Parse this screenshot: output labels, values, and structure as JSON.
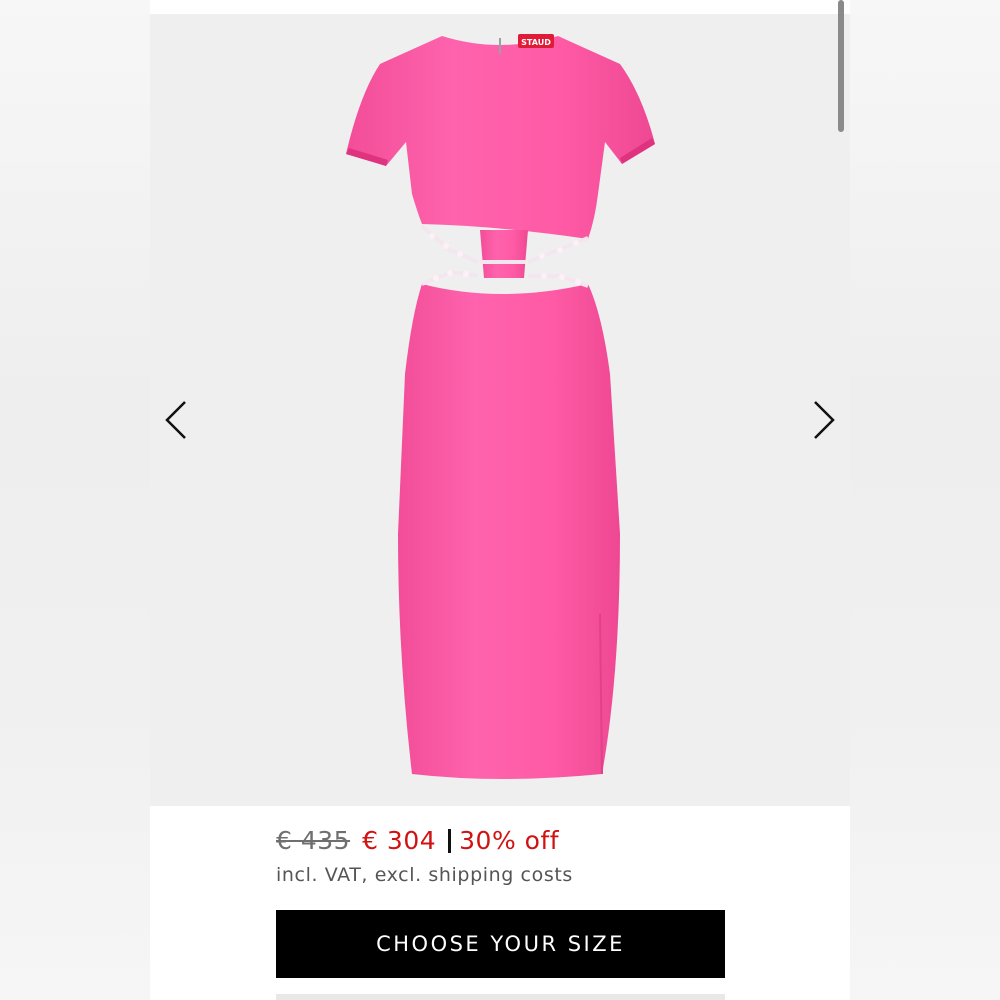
{
  "product": {
    "brand_label": "STAUD",
    "dress_color": "#ff5aa5"
  },
  "gallery": {
    "prev_icon": "chevron-left-icon",
    "next_icon": "chevron-right-icon"
  },
  "price": {
    "original": "€ 435",
    "sale": "€ 304",
    "discount": "30% off",
    "vat_note": "incl. VAT, excl. shipping costs",
    "sale_color": "#d11212"
  },
  "actions": {
    "choose_size_label": "CHOOSE YOUR SIZE"
  }
}
